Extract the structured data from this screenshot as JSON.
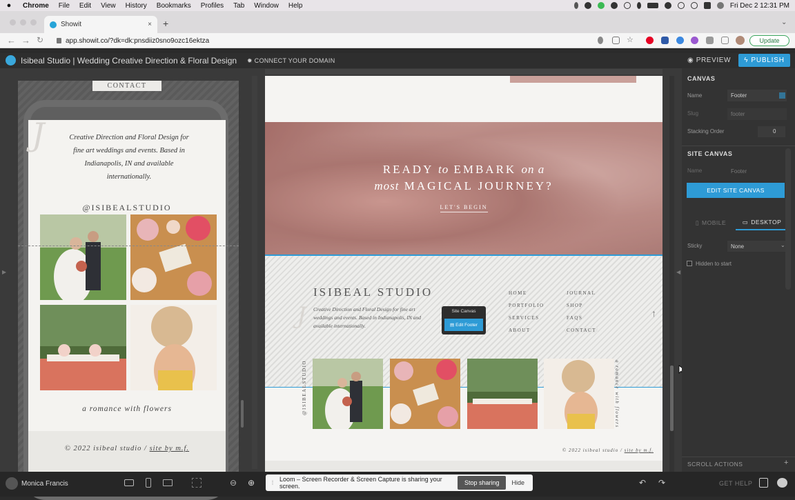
{
  "menubar": {
    "app": "Chrome",
    "items": [
      "File",
      "Edit",
      "View",
      "History",
      "Bookmarks",
      "Profiles",
      "Tab",
      "Window",
      "Help"
    ],
    "datetime": "Fri Dec 2  12:31 PM"
  },
  "browser": {
    "tab_title": "Showit",
    "tab_close": "×",
    "new_tab": "+",
    "url": "app.showit.co/?dk=dk:pnsdiiz0sno9ozc16ektza",
    "update_label": "Update"
  },
  "app": {
    "site_title": "Isibeal Studio | Wedding Creative Direction & Floral Design",
    "connect_domain": "CONNECT YOUR DOMAIN",
    "preview": "PREVIEW",
    "publish": "PUBLISH"
  },
  "mobile": {
    "top_label": "CONTACT",
    "tagline": "Creative Direction and Floral Design for fine art weddings and events. Based in Indianapolis, IN and available internationally.",
    "handle": "@ISIBEALSTUDIO",
    "romance": "a romance with flowers",
    "copyright": "© 2022 isibeal studio / ",
    "site_by": "site by m.f."
  },
  "desktop": {
    "hero_line1_a": "READY",
    "hero_line1_b": "to",
    "hero_line1_c": "EMBARK",
    "hero_line1_d": "on a",
    "hero_line2_a": "most",
    "hero_line2_b": "MAGICAL JOURNEY?",
    "hero_cta": "LET'S BEGIN",
    "footer_brand": "ISIBEAL STUDIO",
    "footer_tagline": "Creative Direction and Floral Design for fine art weddings and events. Based in Indianapolis, IN and available internationally.",
    "nav_col1": [
      "HOME",
      "PORTFOLIO",
      "SERVICES",
      "ABOUT"
    ],
    "nav_col2": [
      "JOURNAL",
      "SHOP",
      "FAQS",
      "CONTACT"
    ],
    "site_canvas_label": "Site Canvas",
    "edit_footer": "Edit Footer",
    "vertical_left": "@ISIBEALSTUDIO",
    "vertical_right": "a romance with flowers",
    "copyright": "© 2022 isibeal studio / ",
    "site_by": "site by m.f."
  },
  "panel": {
    "canvas_header": "CANVAS",
    "name_label": "Name",
    "name_value": "Footer",
    "slug_label": "Slug",
    "slug_value": "footer",
    "stacking_label": "Stacking Order",
    "stacking_value": "0",
    "site_canvas_header": "SITE CANVAS",
    "site_name_label": "Name",
    "site_name_value": "Footer",
    "edit_site_canvas": "EDIT SITE CANVAS",
    "tab_mobile": "MOBILE",
    "tab_desktop": "DESKTOP",
    "sticky_label": "Sticky",
    "sticky_value": "None",
    "hidden_label": "Hidden to start",
    "scroll_actions": "SCROLL ACTIONS",
    "scroll_actions_add": "+"
  },
  "bottom": {
    "user": "Monica Francis",
    "loom_msg": "Loom – Screen Recorder & Screen Capture is sharing your screen.",
    "stop_sharing": "Stop sharing",
    "hide": "Hide",
    "get_help": "GET HELP"
  },
  "colors": {
    "accent": "#2e9bd6",
    "panel_bg": "#333333",
    "canvas_bg": "#f5f4f2"
  }
}
